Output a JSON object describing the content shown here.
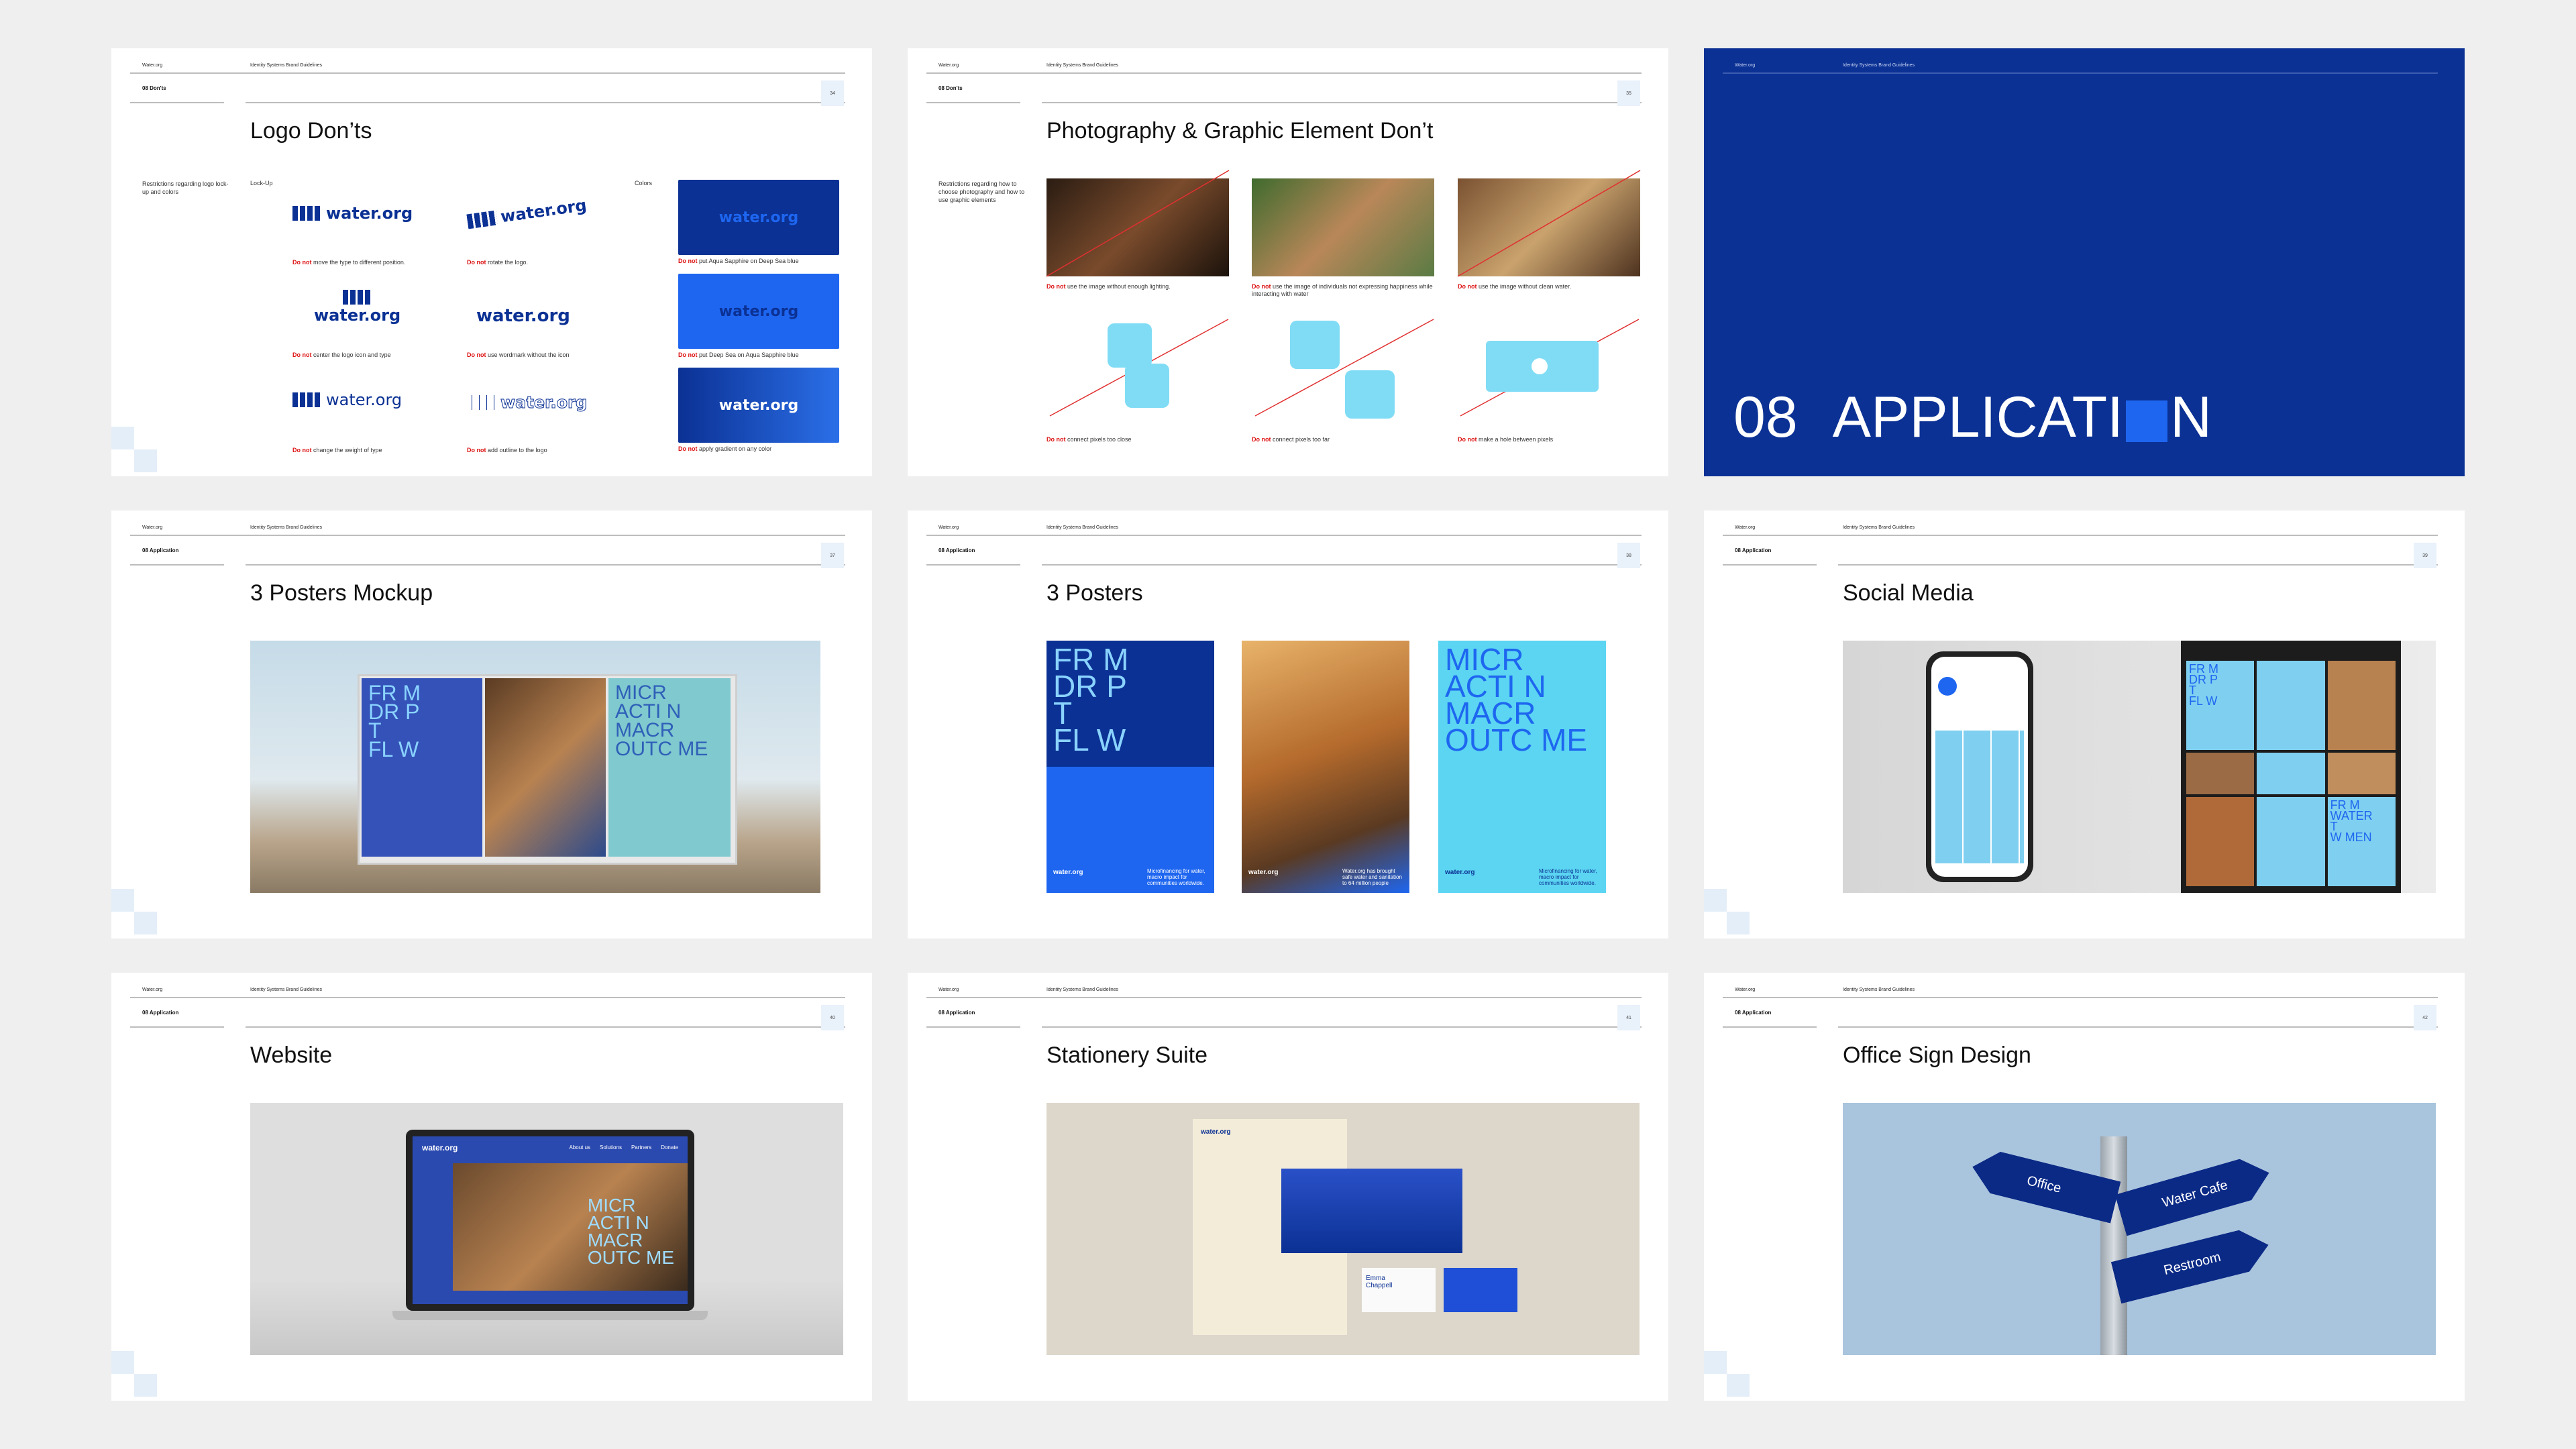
{
  "common": {
    "org": "Water.org",
    "doc": "Identity Systems Brand Guidelines"
  },
  "s1": {
    "section": "08 Don'ts",
    "page": "34",
    "title": "Logo Don’ts",
    "desc": "Restrictions regarding logo lock-up and colors",
    "lockup_label": "Lock-Up",
    "colors_label": "Colors",
    "logo_text": "water.org",
    "caps": [
      {
        "b": "Do not",
        "t": " move the type to different position."
      },
      {
        "b": "Do not",
        "t": " rotate the logo."
      },
      {
        "b": "Do not",
        "t": " center the logo icon and type"
      },
      {
        "b": "Do not",
        "t": " use wordmark without the icon"
      },
      {
        "b": "Do not",
        "t": " change the weight of type"
      },
      {
        "b": "Do not",
        "t": " add outline to the logo"
      },
      {
        "b": "Do not",
        "t": " put Aqua Sapphire on Deep Sea blue"
      },
      {
        "b": "Do not",
        "t": " put Deep Sea on Aqua Sapphire blue"
      },
      {
        "b": "Do not",
        "t": " apply gradient on any color"
      }
    ]
  },
  "s2": {
    "section": "08 Don'ts",
    "page": "35",
    "title": "Photography & Graphic Element Don’t",
    "desc": "Restrictions regarding how to choose photography and how to use graphic elements",
    "caps": [
      {
        "b": "Do not",
        "t": " use the image without enough lighting."
      },
      {
        "b": "Do not",
        "t": " use the image of individuals not expressing happiness while interacting with water"
      },
      {
        "b": "Do not",
        "t": " use the image without clean water."
      },
      {
        "b": "Do not",
        "t": " connect pixels too close"
      },
      {
        "b": "Do not",
        "t": " connect pixels too far"
      },
      {
        "b": "Do not",
        "t": " make a hole between pixels"
      }
    ]
  },
  "s3": {
    "num": "08",
    "word_a": "APPLICATI",
    "word_b": "N"
  },
  "s4": {
    "section": "08 Application",
    "page": "37",
    "title": "3 Posters Mockup",
    "p1": [
      "FR  M",
      "DR  P",
      "T",
      "FL  W"
    ],
    "p3": [
      "MICR",
      "ACTI  N",
      "MACR",
      "OUTC  ME"
    ]
  },
  "s5": {
    "section": "08 Application",
    "page": "38",
    "title": "3 Posters",
    "p1": [
      "FR  M",
      "DR  P",
      "T",
      "FL  W"
    ],
    "p3": [
      "MICR",
      "ACTI  N",
      "MACR",
      "OUTC  ME"
    ],
    "logo": "water.org",
    "c1": "Microfinancing for water, macro impact for communities worldwide.",
    "c2": "Water.org has brought safe water and sanitation to 64 million people",
    "c3": "Microfinancing for water, macro impact for communities worldwide."
  },
  "s6": {
    "section": "08 Application",
    "page": "39",
    "title": "Social Media",
    "grid": [
      "FR  M",
      "DR  P",
      "T",
      "FL  W",
      "FR  M",
      "WATER",
      "T",
      "W  MEN"
    ]
  },
  "s7": {
    "section": "08 Application",
    "page": "40",
    "title": "Website",
    "brand": "water.org",
    "nav": [
      "About us",
      "Solutions",
      "Partners",
      "Donate"
    ],
    "hero": [
      "MICR",
      "ACTI  N",
      "MACR",
      "OUTC  ME"
    ]
  },
  "s8": {
    "section": "08 Application",
    "page": "41",
    "title": "Stationery Suite",
    "brand": "water.org",
    "name": "Emma Chappell"
  },
  "s9": {
    "section": "08 Application",
    "page": "42",
    "title": "Office Sign Design",
    "signs": [
      "Office",
      "Water Cafe",
      "Restroom"
    ]
  }
}
